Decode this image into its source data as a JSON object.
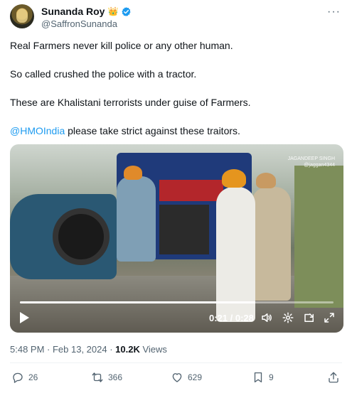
{
  "author": {
    "display_name": "Sunanda Roy",
    "badge_emoji": "👑",
    "handle": "@SaffronSunanda"
  },
  "tweet": {
    "line1": "Real Farmers never kill police or any other human.",
    "line2": "So called crushed the police with a tractor.",
    "line3": "These are Khalistani terrorists under guise of Farmers.",
    "mention": "@HMOIndia",
    "line4_rest": " please take strict against these traitors."
  },
  "video": {
    "watermark_line1": "JAGANDEEP SINGH",
    "watermark_line2": "@jaggan4344",
    "current_time": "0:21",
    "separator": " / ",
    "duration": "0:28",
    "progress_fraction": 0.75
  },
  "meta": {
    "timestamp": "5:48 PM · Feb 13, 2024 · ",
    "views_count": "10.2K",
    "views_label": " Views"
  },
  "actions": {
    "replies": "26",
    "reposts": "366",
    "likes": "629",
    "bookmarks": "9"
  },
  "colors": {
    "link": "#1d9bf0",
    "secondary_text": "#536471",
    "verified": "#1d9bf0"
  }
}
